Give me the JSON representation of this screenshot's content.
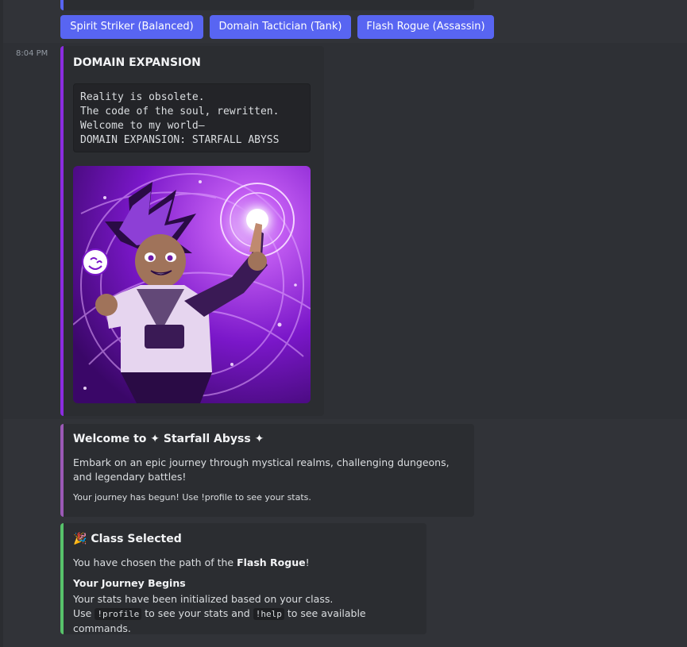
{
  "buttons": [
    {
      "label": "Spirit Striker (Balanced)"
    },
    {
      "label": "Domain Tactician (Tank)"
    },
    {
      "label": "Flash Rogue (Assassin)"
    }
  ],
  "message": {
    "timestamp": "8:04 PM"
  },
  "domain_embed": {
    "title": "DOMAIN EXPANSION",
    "code_lines": [
      "Reality is obsolete.",
      "The code of the soul, rewritten.",
      "Welcome to my world—",
      "DOMAIN EXPANSION: STARFALL ABYSS"
    ],
    "accent_color": "#8b2ce0"
  },
  "welcome_embed": {
    "title_prefix": "Welcome to",
    "sparkle": "✦",
    "title_name": "Starfall Abyss",
    "description": "Embark on an epic journey through mystical realms, challenging dungeons, and legendary battles!",
    "footer": "Your journey has begun! Use !profile to see your stats.",
    "accent_color": "#9b59b6"
  },
  "class_embed": {
    "emoji": "🎉",
    "title": "Class Selected",
    "desc_before": "You have chosen the path of the ",
    "class_name": "Flash Rogue",
    "desc_after": "!",
    "field_name": "Your Journey Begins",
    "field_line1": "Your stats have been initialized based on your class.",
    "use_text": "Use ",
    "profile_cmd": "!profile",
    "mid_text": " to see your stats and ",
    "help_cmd": "!help",
    "end_text": " to see available commands.",
    "accent_color": "#57c26a"
  },
  "colors": {
    "background": "#313338",
    "embed_bg": "#2b2d31",
    "button": "#5865f2"
  }
}
